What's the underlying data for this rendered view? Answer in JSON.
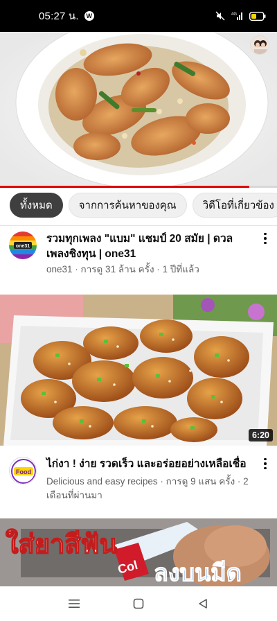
{
  "status_bar": {
    "time": "05:27 น.",
    "app_badge": "W",
    "battery_color": "#f5d400"
  },
  "hero_video": {
    "progress_fraction": 0.9,
    "progress_color": "#e00000"
  },
  "filter_chips": [
    {
      "label": "ทั้งหมด",
      "selected": true
    },
    {
      "label": "จากการค้นหาของคุณ",
      "selected": false
    },
    {
      "label": "วิดีโอที่เกี่ยวข้อง",
      "selected": false
    }
  ],
  "videos": [
    {
      "title": "รวมทุกเพลง \"แบม\" แชมป์ 20 สมัย | ดวลเพลงชิงทุน | one31",
      "meta": "one31 · การดู 31 ล้าน ครั้ง · 1 ปีที่แล้ว",
      "channel_logo_text": "one31"
    },
    {
      "title": "ไก่งา ! ง่าย รวดเร็ว และอร่อยอย่างเหลือเชื่อ",
      "meta": "Delicious and easy recipes · การดู 9 แสน ครั้ง · 2 เดือนที่ผ่านมา",
      "channel_logo_text": "Food",
      "duration": "6:20"
    },
    {
      "thumbnail_overlay_text_top": "ใส่ยาสีฟัน",
      "thumbnail_overlay_text_bottom": "ลงบนมีด",
      "thumbnail_brand_text": "Col"
    }
  ],
  "icons": {
    "more": "more-vert-icon",
    "nav_menu": "menu-icon",
    "nav_home": "home-square-icon",
    "nav_back": "back-triangle-icon"
  }
}
